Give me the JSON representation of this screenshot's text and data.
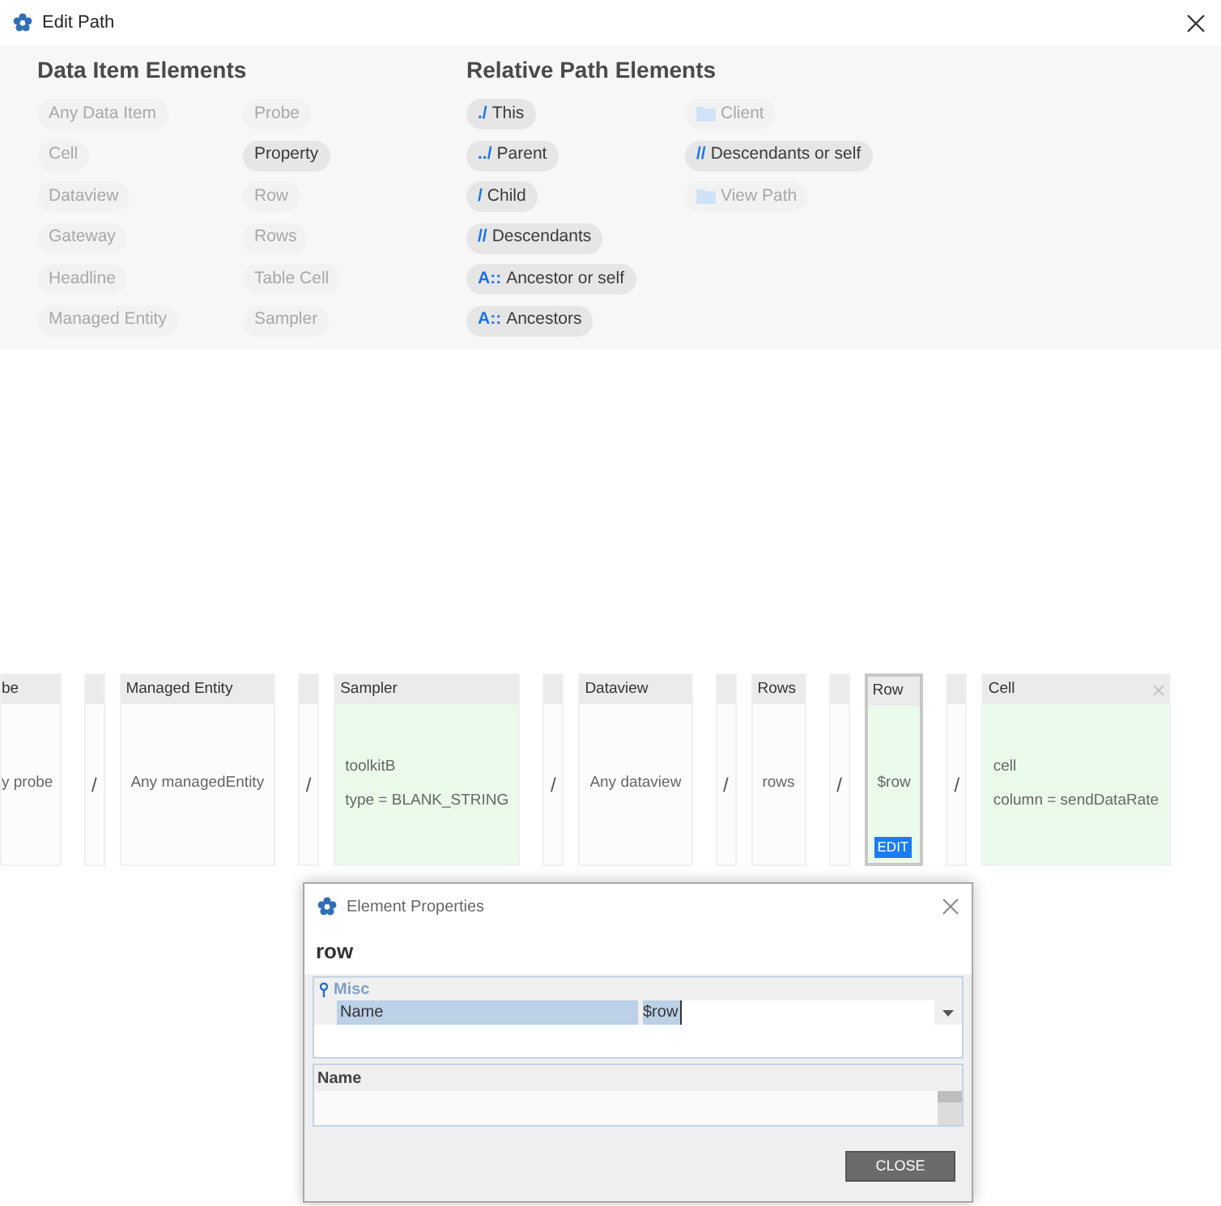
{
  "window": {
    "title": "Edit Path"
  },
  "data_item_elements": {
    "title": "Data Item Elements",
    "columns": [
      [
        {
          "label": "Any Data Item",
          "disabled": true
        },
        {
          "label": "Cell",
          "disabled": true
        },
        {
          "label": "Dataview",
          "disabled": true
        },
        {
          "label": "Gateway",
          "disabled": true
        },
        {
          "label": "Headline",
          "disabled": true
        },
        {
          "label": "Managed Entity",
          "disabled": true
        }
      ],
      [
        {
          "label": "Probe",
          "disabled": true
        },
        {
          "label": "Property",
          "disabled": false
        },
        {
          "label": "Row",
          "disabled": true
        },
        {
          "label": "Rows",
          "disabled": true
        },
        {
          "label": "Table Cell",
          "disabled": true
        },
        {
          "label": "Sampler",
          "disabled": true
        }
      ]
    ]
  },
  "relative_path_elements": {
    "title": "Relative Path Elements",
    "columns": [
      [
        {
          "kind": "prefix",
          "prefix": "./",
          "label": "This",
          "disabled": false
        },
        {
          "kind": "prefix",
          "prefix": "../",
          "label": "Parent",
          "disabled": false
        },
        {
          "kind": "prefix",
          "prefix": "/",
          "label": "Child",
          "disabled": false
        },
        {
          "kind": "prefix",
          "prefix": "//",
          "label": "Descendants",
          "disabled": false
        },
        {
          "kind": "prefix",
          "prefix": "A::",
          "label": "Ancestor or self",
          "disabled": false
        },
        {
          "kind": "prefix",
          "prefix": "A::",
          "label": "Ancestors",
          "disabled": false
        }
      ],
      [
        {
          "kind": "folder",
          "label": "Client",
          "disabled": true
        },
        {
          "kind": "prefix",
          "prefix": "//",
          "label": "Descendants or self",
          "disabled": false
        },
        {
          "kind": "folder",
          "label": "View Path",
          "disabled": true
        }
      ]
    ]
  },
  "path": [
    {
      "kind": "element",
      "header": "be",
      "lines": [
        "y probe"
      ],
      "matched": false,
      "selected": false
    },
    {
      "kind": "separator",
      "symbol": "/"
    },
    {
      "kind": "element",
      "header": "Managed Entity",
      "lines": [
        "Any managedEntity"
      ],
      "matched": false,
      "selected": false
    },
    {
      "kind": "separator",
      "symbol": "/"
    },
    {
      "kind": "element",
      "header": "Sampler",
      "lines": [
        "toolkitB",
        "type = BLANK_STRING"
      ],
      "matched": true,
      "selected": false
    },
    {
      "kind": "separator",
      "symbol": "/"
    },
    {
      "kind": "element",
      "header": "Dataview",
      "lines": [
        "Any dataview"
      ],
      "matched": false,
      "selected": false
    },
    {
      "kind": "separator",
      "symbol": "/"
    },
    {
      "kind": "element",
      "header": "Rows",
      "lines": [
        "rows"
      ],
      "matched": false,
      "selected": false
    },
    {
      "kind": "separator",
      "symbol": "/"
    },
    {
      "kind": "element",
      "header": "Row",
      "lines": [
        "$row"
      ],
      "matched": true,
      "selected": true,
      "edit_button": "EDIT"
    },
    {
      "kind": "separator",
      "symbol": "/"
    },
    {
      "kind": "element",
      "header": "Cell",
      "lines": [
        "cell",
        "column = sendDataRate"
      ],
      "matched": true,
      "selected": false,
      "removable": true
    }
  ],
  "element_properties": {
    "title": "Element Properties",
    "heading": "row",
    "category": "Misc",
    "properties": [
      {
        "name": "Name",
        "value": "$row",
        "selected": true
      }
    ],
    "description": {
      "title": "Name"
    },
    "close_button": "CLOSE"
  }
}
